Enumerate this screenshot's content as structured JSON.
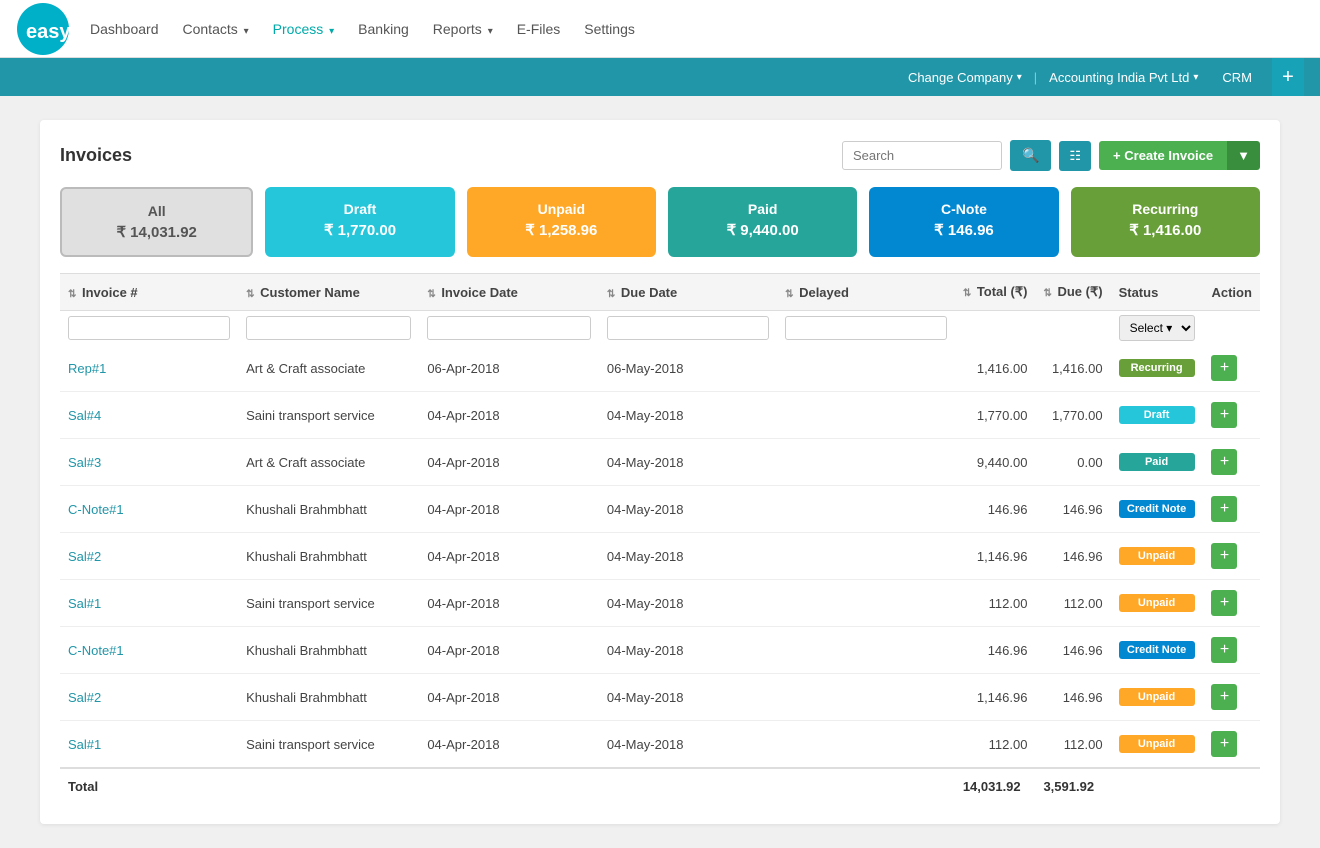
{
  "app": {
    "logo_text": "easy"
  },
  "nav": {
    "links": [
      {
        "label": "Dashboard",
        "active": false
      },
      {
        "label": "Contacts",
        "has_arrow": true,
        "active": false
      },
      {
        "label": "Process",
        "has_arrow": true,
        "active": true
      },
      {
        "label": "Banking",
        "has_arrow": false,
        "active": false
      },
      {
        "label": "Reports",
        "has_arrow": true,
        "active": false
      },
      {
        "label": "E-Files",
        "has_arrow": false,
        "active": false
      },
      {
        "label": "Settings",
        "has_arrow": false,
        "active": false
      }
    ]
  },
  "blue_bar": {
    "change_company": "Change Company",
    "company_name": "Accounting India Pvt Ltd",
    "crm": "CRM",
    "plus": "+"
  },
  "page": {
    "title": "Invoices",
    "search_placeholder": "Search"
  },
  "buttons": {
    "search": "🔍",
    "grid": "⊞",
    "create_invoice": "+ Create Invoice",
    "create_arrow": "▼"
  },
  "status_cards": [
    {
      "key": "all",
      "label": "All",
      "amount": "₹ 14,031.92",
      "class": "all"
    },
    {
      "key": "draft",
      "label": "Draft",
      "amount": "₹ 1,770.00",
      "class": "draft"
    },
    {
      "key": "unpaid",
      "label": "Unpaid",
      "amount": "₹ 1,258.96",
      "class": "unpaid"
    },
    {
      "key": "paid",
      "label": "Paid",
      "amount": "₹ 9,440.00",
      "class": "paid"
    },
    {
      "key": "cnote",
      "label": "C-Note",
      "amount": "₹ 146.96",
      "class": "cnote"
    },
    {
      "key": "recurring",
      "label": "Recurring",
      "amount": "₹ 1,416.00",
      "class": "recurring"
    }
  ],
  "table": {
    "columns": [
      {
        "label": "Invoice #",
        "sortable": true
      },
      {
        "label": "Customer Name",
        "sortable": true
      },
      {
        "label": "Invoice Date",
        "sortable": true
      },
      {
        "label": "Due Date",
        "sortable": true
      },
      {
        "label": "Delayed",
        "sortable": true
      },
      {
        "label": "Total (₹)",
        "sortable": true
      },
      {
        "label": "Due (₹)",
        "sortable": true
      },
      {
        "label": "Status",
        "sortable": false
      },
      {
        "label": "Action",
        "sortable": false
      }
    ],
    "filter_select_placeholder": "Select ▾",
    "rows": [
      {
        "invoice": "Rep#1",
        "customer": "Art & Craft associate",
        "invoice_date": "06-Apr-2018",
        "due_date": "06-May-2018",
        "delayed": "",
        "total": "1,416.00",
        "due": "1,416.00",
        "status": "Recurring",
        "status_class": "recurring"
      },
      {
        "invoice": "Sal#4",
        "customer": "Saini transport service",
        "invoice_date": "04-Apr-2018",
        "due_date": "04-May-2018",
        "delayed": "",
        "total": "1,770.00",
        "due": "1,770.00",
        "status": "Draft",
        "status_class": "draft"
      },
      {
        "invoice": "Sal#3",
        "customer": "Art & Craft associate",
        "invoice_date": "04-Apr-2018",
        "due_date": "04-May-2018",
        "delayed": "",
        "total": "9,440.00",
        "due": "0.00",
        "status": "Paid",
        "status_class": "paid"
      },
      {
        "invoice": "C-Note#1",
        "customer": "Khushali Brahmbhatt",
        "invoice_date": "04-Apr-2018",
        "due_date": "04-May-2018",
        "delayed": "",
        "total": "146.96",
        "due": "146.96",
        "status": "Credit Note",
        "status_class": "credit-note"
      },
      {
        "invoice": "Sal#2",
        "customer": "Khushali Brahmbhatt",
        "invoice_date": "04-Apr-2018",
        "due_date": "04-May-2018",
        "delayed": "",
        "total": "1,146.96",
        "due": "146.96",
        "status": "Unpaid",
        "status_class": "unpaid"
      },
      {
        "invoice": "Sal#1",
        "customer": "Saini transport service",
        "invoice_date": "04-Apr-2018",
        "due_date": "04-May-2018",
        "delayed": "",
        "total": "112.00",
        "due": "112.00",
        "status": "Unpaid",
        "status_class": "unpaid"
      },
      {
        "invoice": "C-Note#1",
        "customer": "Khushali Brahmbhatt",
        "invoice_date": "04-Apr-2018",
        "due_date": "04-May-2018",
        "delayed": "",
        "total": "146.96",
        "due": "146.96",
        "status": "Credit Note",
        "status_class": "credit-note"
      },
      {
        "invoice": "Sal#2",
        "customer": "Khushali Brahmbhatt",
        "invoice_date": "04-Apr-2018",
        "due_date": "04-May-2018",
        "delayed": "",
        "total": "1,146.96",
        "due": "146.96",
        "status": "Unpaid",
        "status_class": "unpaid"
      },
      {
        "invoice": "Sal#1",
        "customer": "Saini transport service",
        "invoice_date": "04-Apr-2018",
        "due_date": "04-May-2018",
        "delayed": "",
        "total": "112.00",
        "due": "112.00",
        "status": "Unpaid",
        "status_class": "unpaid"
      }
    ],
    "footer": {
      "label": "Total",
      "total": "14,031.92",
      "due": "3,591.92"
    }
  }
}
